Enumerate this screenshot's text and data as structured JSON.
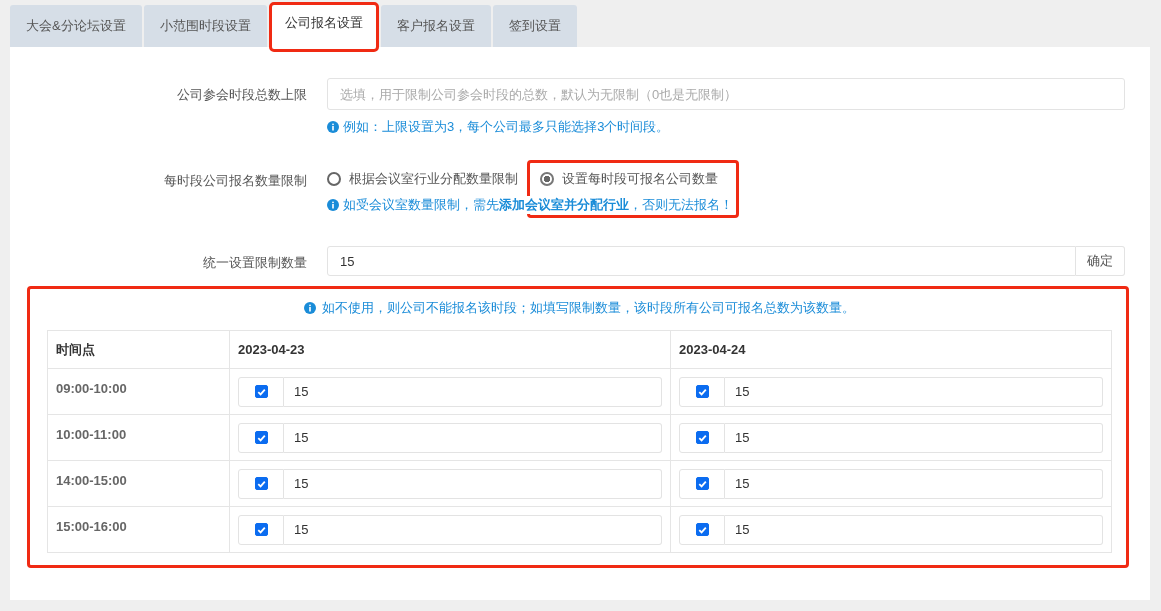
{
  "tabs": [
    {
      "label": "大会&分论坛设置",
      "selected": false,
      "highlighted": false
    },
    {
      "label": "小范围时段设置",
      "selected": false,
      "highlighted": false
    },
    {
      "label": "公司报名设置",
      "selected": true,
      "highlighted": true
    },
    {
      "label": "客户报名设置",
      "selected": false,
      "highlighted": false
    },
    {
      "label": "签到设置",
      "selected": false,
      "highlighted": false
    }
  ],
  "total_limit": {
    "label": "公司参会时段总数上限",
    "placeholder": "选填，用于限制公司参会时段的总数，默认为无限制（0也是无限制）",
    "hint": "例如：上限设置为3，每个公司最多只能选择3个时间段。"
  },
  "per_slot_limit": {
    "label": "每时段公司报名数量限制",
    "highlighted": true,
    "options": [
      {
        "label": "根据会议室行业分配数量限制",
        "selected": false
      },
      {
        "label": "设置每时段可报名公司数量",
        "selected": true
      }
    ],
    "hint": "如受会议室数量限制，需先**添加会议室并分配行业**，否则无法报名！"
  },
  "unified_limit": {
    "label": "统一设置限制数量",
    "value": "15",
    "button": "确定"
  },
  "slot_table": {
    "highlighted": true,
    "note": "如不使用，则公司不能报名该时段；如填写限制数量，该时段所有公司可报名总数为该数量。",
    "columns": [
      "时间点",
      "2023-04-23",
      "2023-04-24"
    ],
    "rows": [
      {
        "cells": [
          {
            "kind": "time",
            "text": "09:00-10:00"
          },
          {
            "kind": "limit",
            "checked": true,
            "value": "15"
          },
          {
            "kind": "limit",
            "checked": true,
            "value": "15"
          }
        ]
      },
      {
        "cells": [
          {
            "kind": "time",
            "text": "10:00-11:00"
          },
          {
            "kind": "limit",
            "checked": true,
            "value": "15"
          },
          {
            "kind": "limit",
            "checked": true,
            "value": "15"
          }
        ]
      },
      {
        "cells": [
          {
            "kind": "time",
            "text": "14:00-15:00"
          },
          {
            "kind": "limit",
            "checked": true,
            "value": "15"
          },
          {
            "kind": "limit",
            "checked": true,
            "value": "15"
          }
        ]
      },
      {
        "cells": [
          {
            "kind": "time",
            "text": "15:00-16:00"
          },
          {
            "kind": "limit",
            "checked": true,
            "value": "15"
          },
          {
            "kind": "limit",
            "checked": true,
            "value": "15"
          }
        ]
      }
    ]
  }
}
